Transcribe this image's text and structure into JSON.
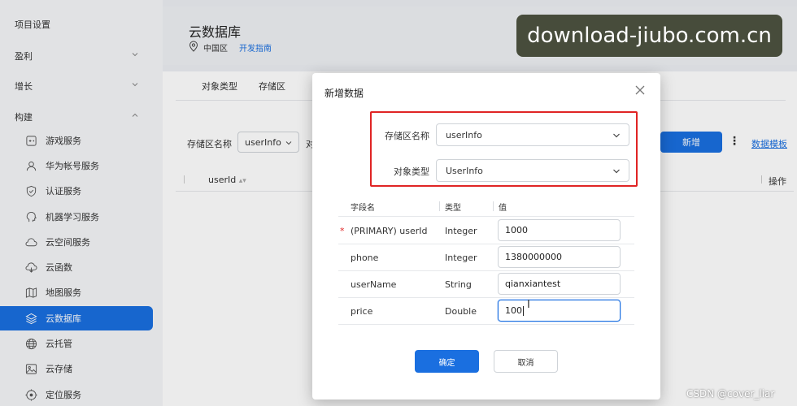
{
  "sidebar": {
    "groups": [
      {
        "label": "项目设置"
      },
      {
        "label": "盈利"
      },
      {
        "label": "增长"
      },
      {
        "label": "构建"
      }
    ],
    "items": [
      {
        "label": "游戏服务",
        "icon": "gamepad-icon"
      },
      {
        "label": "华为帐号服务",
        "icon": "user-icon"
      },
      {
        "label": "认证服务",
        "icon": "shield-icon"
      },
      {
        "label": "机器学习服务",
        "icon": "brain-icon"
      },
      {
        "label": "云空间服务",
        "icon": "cloud-icon"
      },
      {
        "label": "云函数",
        "icon": "cloud-function-icon"
      },
      {
        "label": "地图服务",
        "icon": "map-icon"
      },
      {
        "label": "云数据库",
        "icon": "database-icon",
        "active": true
      },
      {
        "label": "云托管",
        "icon": "globe-icon"
      },
      {
        "label": "云存储",
        "icon": "image-icon"
      },
      {
        "label": "定位服务",
        "icon": "location-icon"
      }
    ]
  },
  "page": {
    "title": "云数据库",
    "region": "中国区",
    "guide_link": "开发指南",
    "tabs": [
      "对象类型",
      "存储区"
    ],
    "filter_label": "存储区名称",
    "filter_value": "userInfo",
    "filter_truncated": "对",
    "add_button": "新增",
    "template_link": "数据模板",
    "col_userid": "userId",
    "col_ops": "操作"
  },
  "dialog": {
    "title": "新增数据",
    "zone_label": "存储区名称",
    "zone_value": "userInfo",
    "type_label": "对象类型",
    "type_value": "UserInfo",
    "table_headers": {
      "field": "字段名",
      "type": "类型",
      "value": "值"
    },
    "rows": [
      {
        "required": true,
        "field": "(PRIMARY) userId",
        "type": "Integer",
        "value": "1000"
      },
      {
        "required": false,
        "field": "phone",
        "type": "Integer",
        "value": "1380000000"
      },
      {
        "required": false,
        "field": "userName",
        "type": "String",
        "value": "qianxiantest"
      },
      {
        "required": false,
        "field": "price",
        "type": "Double",
        "value": "100"
      }
    ],
    "ok_button": "确定",
    "cancel_button": "取消"
  },
  "watermark": "download-jiubo.com.cn",
  "csdn_mark": "CSDN @cover_liar",
  "colors": {
    "accent": "#1a6fe0",
    "highlight_box": "#e02424"
  }
}
